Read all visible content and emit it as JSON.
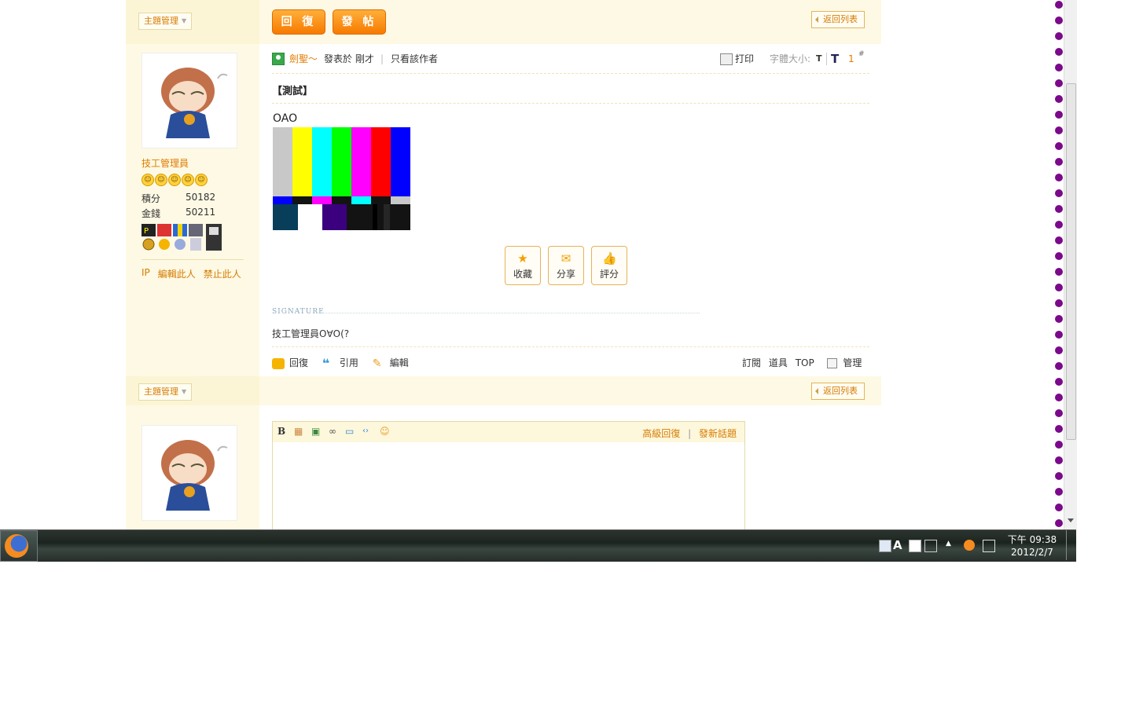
{
  "thread": {
    "manage_label": "主題管理",
    "reply_btn": "回 復",
    "new_post_btn": "發 帖",
    "back_to_list": "返回列表"
  },
  "author": {
    "name": "技工管理員",
    "stats": [
      {
        "label": "積分",
        "value": "50182"
      },
      {
        "label": "金錢",
        "value": "50211"
      }
    ],
    "links": [
      "IP",
      "編輯此人",
      "禁止此人"
    ]
  },
  "post": {
    "poster": "劍聖～",
    "posted_at": "發表於 剛才",
    "separator": "|",
    "only_author": "只看該作者",
    "print": "打印",
    "font_size_label": "字體大小:",
    "font_small": "T",
    "font_large": "T",
    "floor": "1",
    "floor_suffix": "#",
    "title": "【測試】",
    "body": "OAO",
    "actions": [
      "收藏",
      "分享",
      "評分"
    ],
    "signature_label": "SIGNATURE",
    "signature": "技工管理員O∀O(?",
    "footer_left": [
      "回復",
      "引用",
      "編輯"
    ],
    "footer_right": [
      "訂閱",
      "道具",
      "TOP"
    ],
    "manage": "管理"
  },
  "editor": {
    "advanced_reply": "高級回復",
    "separator": "|",
    "new_topic": "發新話題"
  },
  "taskbar": {
    "time": "下午 09:38",
    "date": "2012/2/7"
  },
  "colors": {
    "accent": "#e07b00",
    "band": "#fdf9e4",
    "dots": "#7a0a8a"
  }
}
